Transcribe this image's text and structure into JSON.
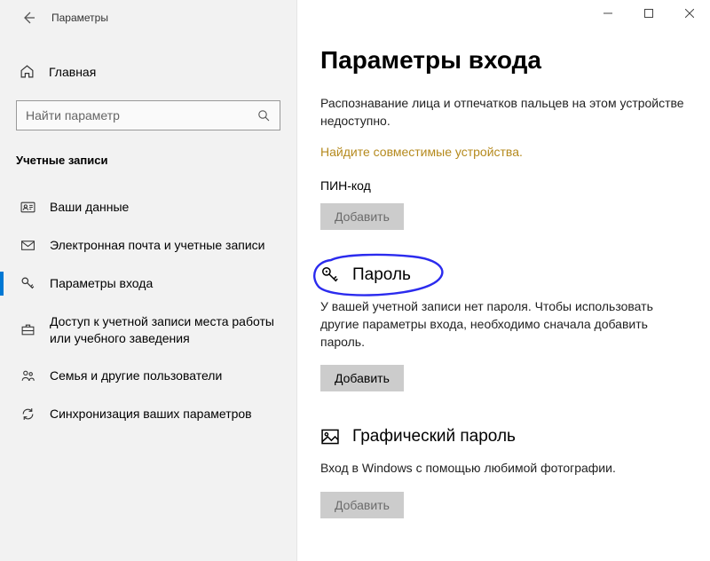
{
  "titlebar": {
    "app_title": "Параметры"
  },
  "sidebar": {
    "home_label": "Главная",
    "search_placeholder": "Найти параметр",
    "section_heading": "Учетные записи",
    "items": [
      {
        "label": "Ваши данные"
      },
      {
        "label": "Электронная почта и учетные записи"
      },
      {
        "label": "Параметры входа"
      },
      {
        "label": "Доступ к учетной записи места работы или учебного заведения"
      },
      {
        "label": "Семья и другие пользователи"
      },
      {
        "label": "Синхронизация ваших параметров"
      }
    ]
  },
  "main": {
    "page_title": "Параметры входа",
    "face_desc": "Распознавание лица и отпечатков пальцев на этом устройстве недоступно.",
    "compatible_link": "Найдите совместимые устройства.",
    "pin_label": "ПИН-код",
    "pin_button": "Добавить",
    "password_title": "Пароль",
    "password_desc": "У вашей учетной записи нет пароля. Чтобы использовать другие параметры входа, необходимо сначала добавить пароль.",
    "password_button": "Добавить",
    "picture_title": "Графический пароль",
    "picture_desc": "Вход в Windows с помощью любимой фотографии.",
    "picture_button": "Добавить"
  }
}
